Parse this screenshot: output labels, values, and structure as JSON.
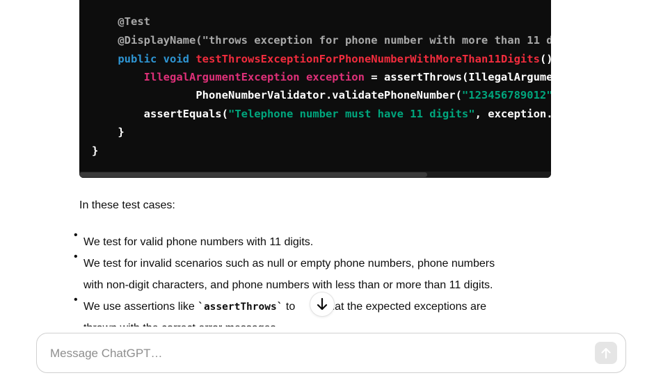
{
  "code_block": {
    "lines": [
      [
        {
          "t": "    ",
          "c": "plain"
        },
        {
          "t": "@Test",
          "c": "ann"
        }
      ],
      [
        {
          "t": "    ",
          "c": "plain"
        },
        {
          "t": "@DisplayName(\"throws exception for phone number with more than 11 d",
          "c": "ann"
        }
      ],
      [
        {
          "t": "    ",
          "c": "plain"
        },
        {
          "t": "public",
          "c": "kw"
        },
        {
          "t": " ",
          "c": "plain"
        },
        {
          "t": "void",
          "c": "kw"
        },
        {
          "t": " ",
          "c": "plain"
        },
        {
          "t": "testThrowsExceptionForPhoneNumberWithMoreThan11Digits",
          "c": "fn"
        },
        {
          "t": "()",
          "c": "plain"
        }
      ],
      [
        {
          "t": "        ",
          "c": "plain"
        },
        {
          "t": "IllegalArgumentException",
          "c": "type"
        },
        {
          "t": " ",
          "c": "plain"
        },
        {
          "t": "exception",
          "c": "type"
        },
        {
          "t": " = assertThrows(IllegalArgume",
          "c": "plain"
        }
      ],
      [
        {
          "t": "                ",
          "c": "plain"
        },
        {
          "t": "PhoneNumberValidator.validatePhoneNumber(",
          "c": "plain"
        },
        {
          "t": "\"123456789012\"",
          "c": "str"
        }
      ],
      [
        {
          "t": "        ",
          "c": "plain"
        },
        {
          "t": "assertEquals(",
          "c": "plain"
        },
        {
          "t": "\"Telephone number must have 11 digits\"",
          "c": "str"
        },
        {
          "t": ", exception.",
          "c": "plain"
        }
      ],
      [
        {
          "t": "    ",
          "c": "plain"
        },
        {
          "t": "}",
          "c": "plain"
        }
      ],
      [
        {
          "t": "}",
          "c": "plain"
        }
      ]
    ]
  },
  "paragraph": "In these test cases:",
  "bullets": [
    {
      "lines": [
        [
          {
            "t": "We test for valid phone numbers with 11 digits."
          }
        ]
      ]
    },
    {
      "lines": [
        [
          {
            "t": "We test for invalid scenarios such as null or empty phone numbers, phone numbers"
          }
        ],
        [
          {
            "t": "with non-digit characters, and phone numbers with less than or more than 11 digits."
          }
        ]
      ]
    },
    {
      "lines": [
        [
          {
            "t": "We use assertions like "
          },
          {
            "t": "`assertThrows`",
            "code": true
          },
          {
            "t": " to "
          },
          {
            "t": "     ",
            "gap": true
          },
          {
            "t": "fy that the expected exceptions are"
          }
        ],
        [
          {
            "t": "thrown with the correct error messages."
          }
        ]
      ]
    }
  ],
  "composer": {
    "placeholder": "Message ChatGPT…",
    "value": ""
  },
  "icons": {
    "scroll_down": "arrow-down-icon",
    "send": "arrow-up-icon"
  },
  "colors": {
    "code_bg": "#0d0d0d",
    "annotation": "#a9a9a9",
    "keyword": "#2e95d3",
    "function": "#f22c3d",
    "type": "#df3079",
    "string": "#00a67d"
  }
}
